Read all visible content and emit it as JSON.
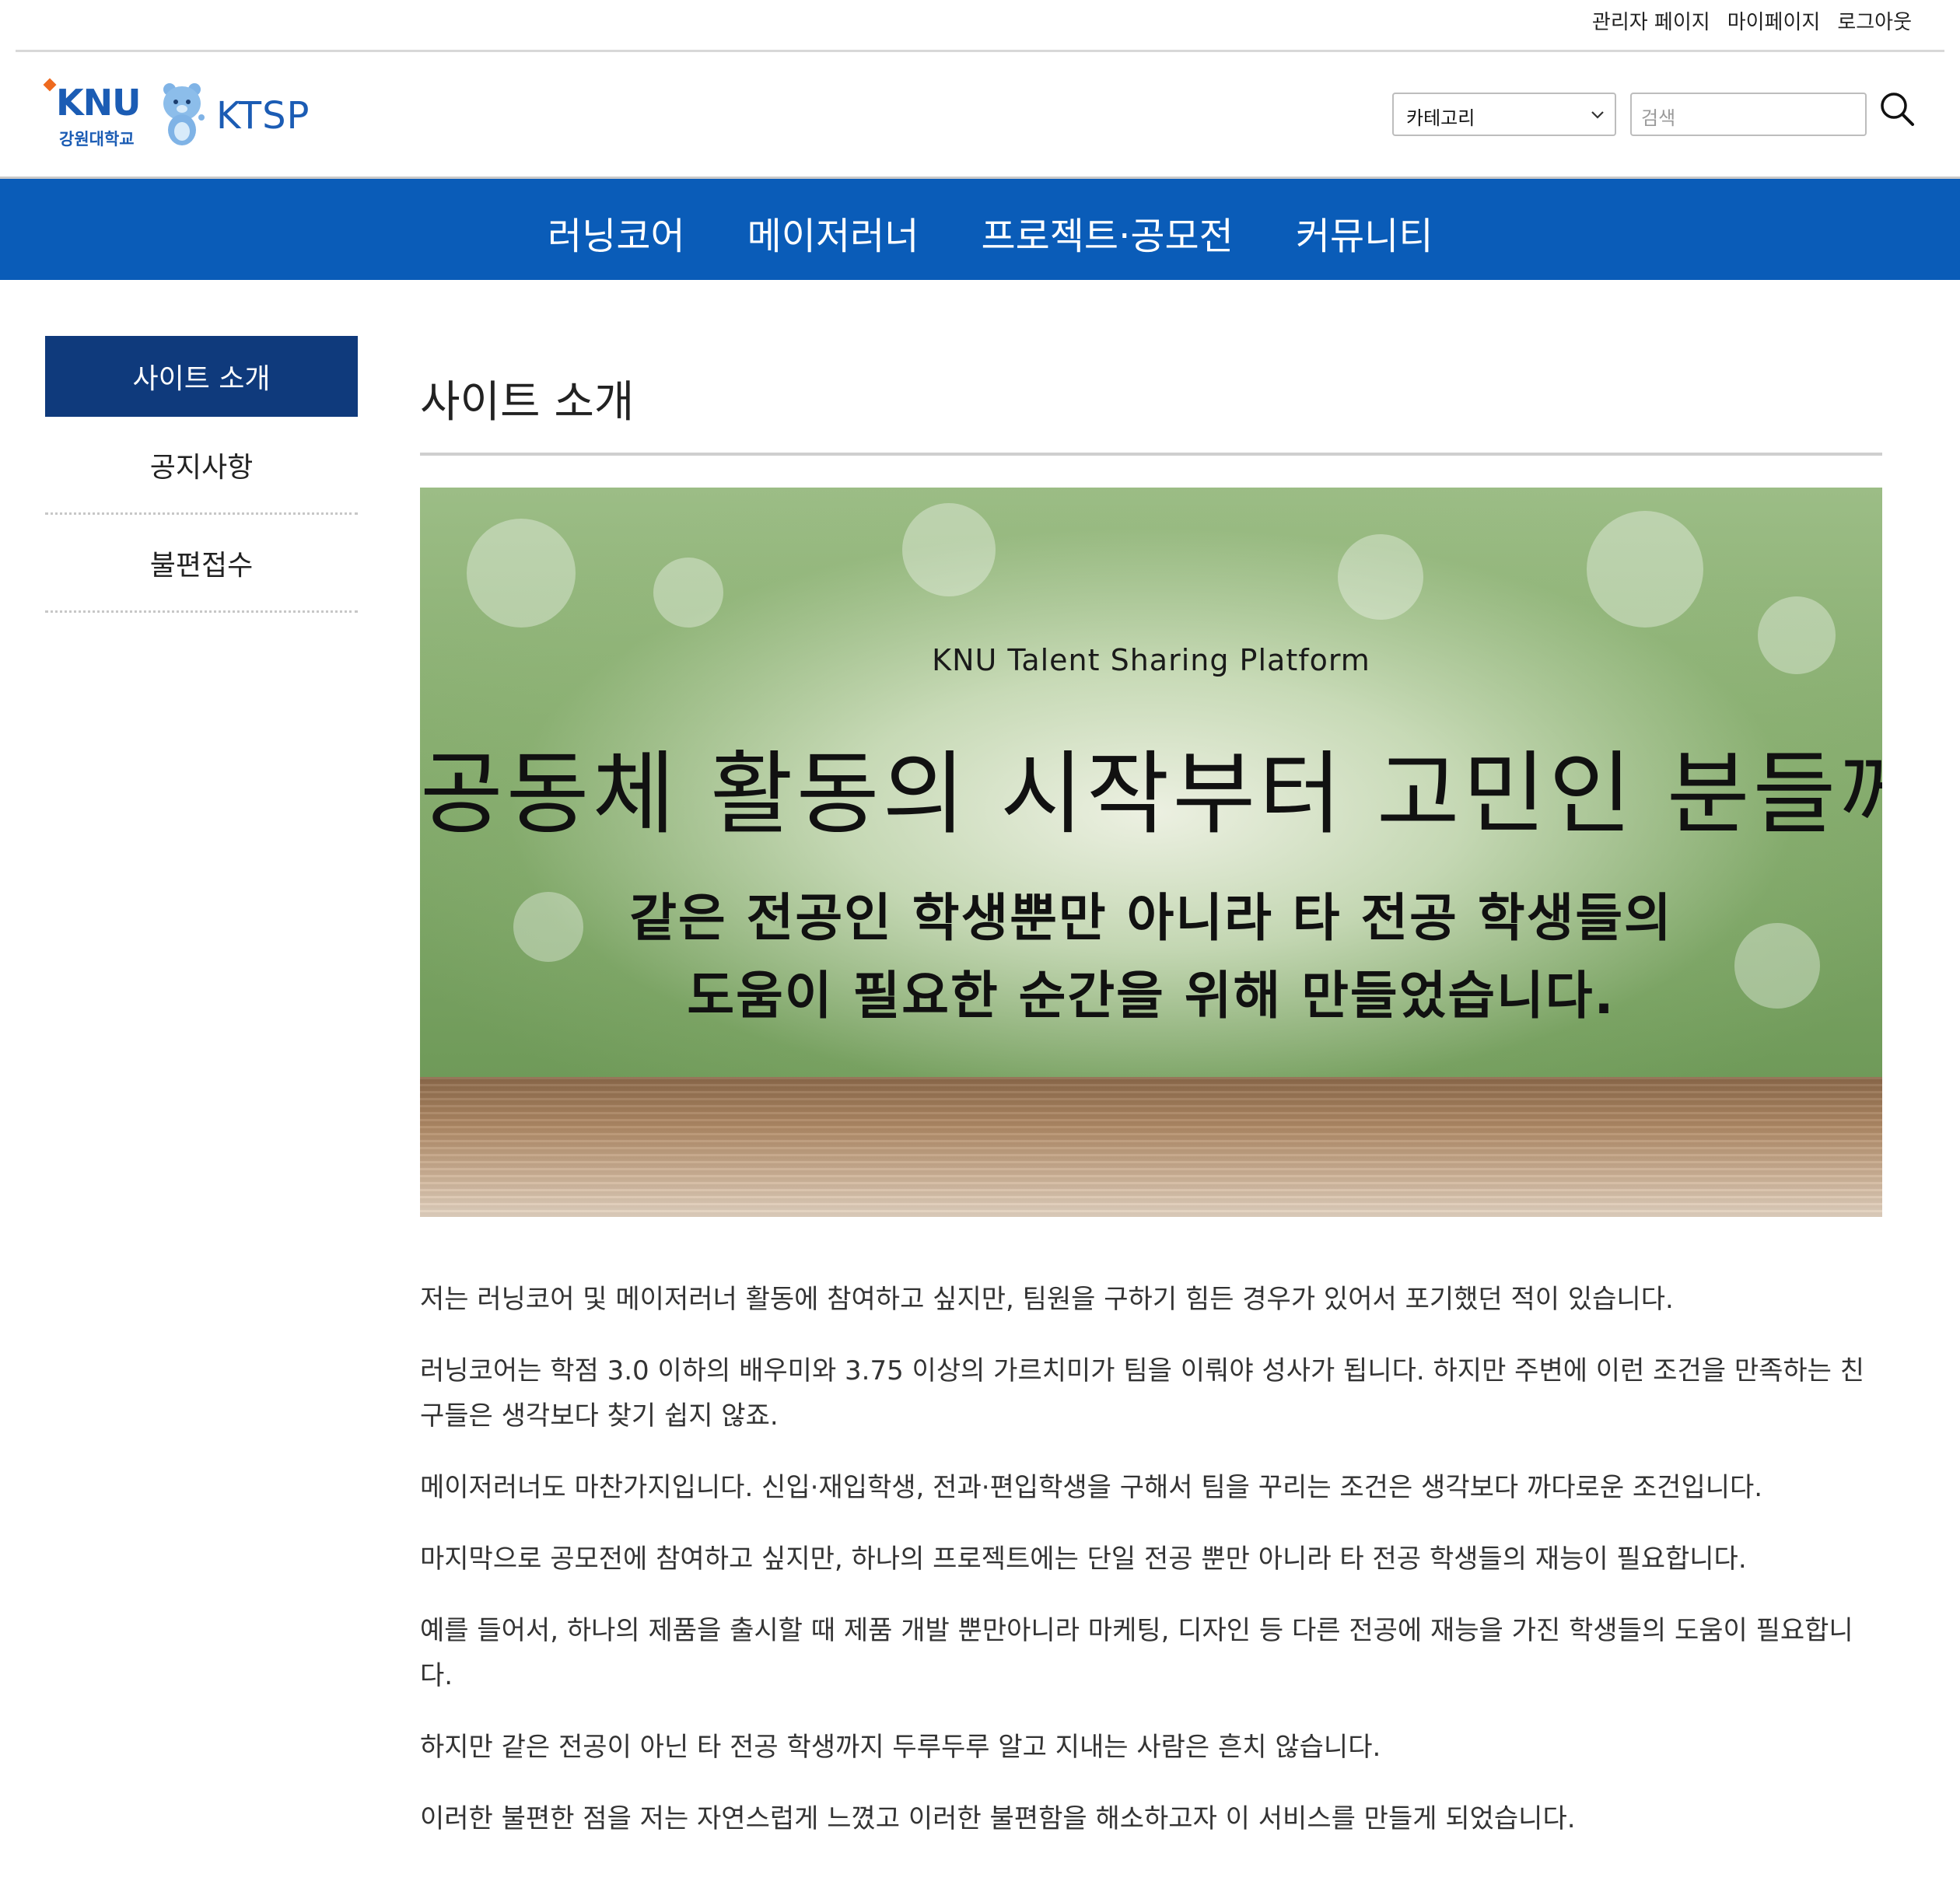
{
  "util_links": {
    "admin": "관리자 페이지",
    "mypage": "마이페이지",
    "logout": "로그아웃"
  },
  "logo": {
    "knu": "KNU",
    "university": "강원대학교",
    "ktsp": "KTSP",
    "brand_color": "#1b5cb4",
    "accent_color": "#ee6a1f"
  },
  "search": {
    "category_selected": "카테고리",
    "placeholder": "검색",
    "icon": "search-icon"
  },
  "nav": {
    "items": [
      "러닝코어",
      "메이저러너",
      "프로젝트·공모전",
      "커뮤니티"
    ],
    "bg_color": "#0a5cb8"
  },
  "sidebar": {
    "items": [
      {
        "label": "사이트 소개",
        "active": true
      },
      {
        "label": "공지사항",
        "active": false
      },
      {
        "label": "불편접수",
        "active": false
      }
    ],
    "active_color": "#0f3a7c"
  },
  "main": {
    "title": "사이트 소개",
    "banner": {
      "small": "KNU Talent Sharing Platform",
      "big": "공동체 활동의 시작부터 고민인 분들께",
      "line1": "같은 전공인 학생뿐만 아니라 타 전공 학생들의",
      "line2": "도움이 필요한 순간을 위해 만들었습니다."
    },
    "paragraphs": [
      "저는 러닝코어 및 메이저러너 활동에 참여하고 싶지만, 팀원을 구하기 힘든 경우가 있어서 포기했던 적이 있습니다.",
      "러닝코어는 학점 3.0 이하의 배우미와 3.75 이상의 가르치미가 팀을 이뤄야 성사가 됩니다. 하지만 주변에 이런 조건을 만족하는 친구들은 생각보다 찾기 쉽지 않죠.",
      "메이저러너도 마찬가지입니다. 신입·재입학생, 전과·편입학생을 구해서 팀을 꾸리는 조건은 생각보다 까다로운 조건입니다.",
      "마지막으로 공모전에 참여하고 싶지만, 하나의 프로젝트에는 단일 전공 뿐만 아니라 타 전공 학생들의 재능이 필요합니다.",
      "예를 들어서, 하나의 제품을 출시할 때 제품 개발 뿐만아니라 마케팅, 디자인 등 다른 전공에 재능을 가진 학생들의 도움이 필요합니다.",
      "하지만 같은 전공이 아닌 타 전공 학생까지 두루두루 알고 지내는 사람은 흔치 않습니다.",
      "이러한 불편한 점을 저는 자연스럽게 느꼈고 이러한 불편함을 해소하고자 이 서비스를 만들게 되었습니다."
    ]
  }
}
